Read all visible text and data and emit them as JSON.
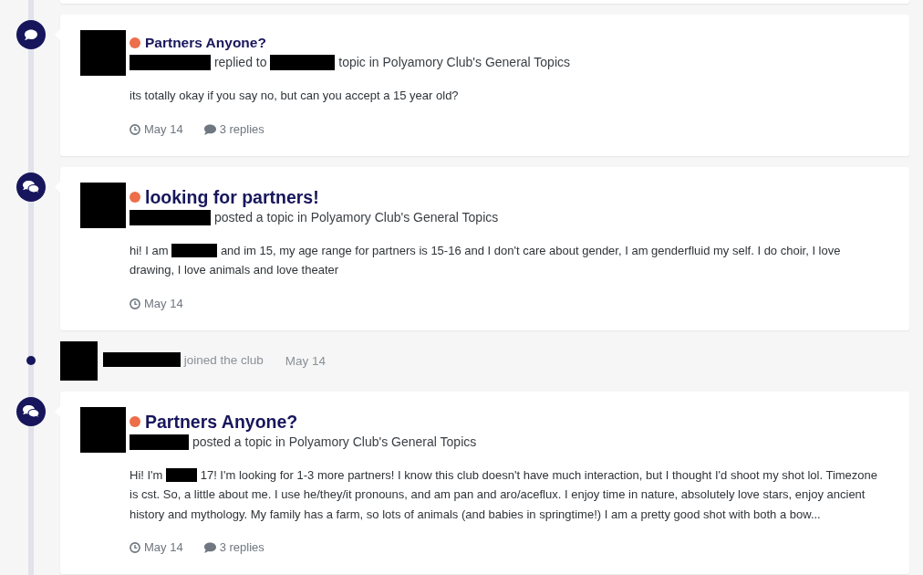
{
  "stream": [
    {
      "kind": "cut_off"
    },
    {
      "kind": "reply",
      "unread": true,
      "title": "Partners Anyone?",
      "activity": [
        {
          "kind": "redacted"
        },
        {
          "kind": "text",
          "text": "replied to"
        },
        {
          "kind": "redacted"
        },
        {
          "kind": "text",
          "text": "topic in Polyamory Club's General Topics"
        }
      ],
      "excerpt": [
        {
          "kind": "text",
          "text": "its totally okay if you say no, but can you accept a 15 year old?"
        }
      ],
      "date": "May 14",
      "replies": "3 replies"
    },
    {
      "kind": "topic",
      "unread": true,
      "title": "looking for partners!",
      "activity": [
        {
          "kind": "redacted"
        },
        {
          "kind": "text",
          "text": "posted a topic in Polyamory Club's General Topics"
        }
      ],
      "excerpt": [
        {
          "kind": "text",
          "text": "hi! I am"
        },
        {
          "kind": "redacted"
        },
        {
          "kind": "text",
          "text": "and im 15, my age range for partners is 15-16 and I don't care about gender, I am genderfluid my self. I do choir, I love drawing, I love animals and love theater"
        }
      ],
      "date": "May 14"
    },
    {
      "kind": "join",
      "activity": [
        {
          "kind": "redacted"
        },
        {
          "kind": "text",
          "text": "joined the club"
        }
      ],
      "date": "May 14"
    },
    {
      "kind": "topic",
      "unread": true,
      "title": "Partners Anyone?",
      "activity": [
        {
          "kind": "redacted"
        },
        {
          "kind": "text",
          "text": "posted a topic in Polyamory Club's General Topics"
        }
      ],
      "excerpt": [
        {
          "kind": "text",
          "text": "Hi! I'm"
        },
        {
          "kind": "redacted"
        },
        {
          "kind": "text",
          "text": "17! I'm looking for 1-3 more partners! I know this club doesn't have much interaction, but I thought I'd shoot my shot lol. Timezone is cst. So, a little about me. I use he/they/it pronouns, and am pan and aro/aceflux. I enjoy time in nature, absolutely love stars, enjoy ancient history and mythology. My family has a farm, so lots of animals (and babies in springtime!) I am a pretty good shot with both a bow..."
        }
      ],
      "date": "May 14",
      "replies": "3 replies"
    }
  ]
}
